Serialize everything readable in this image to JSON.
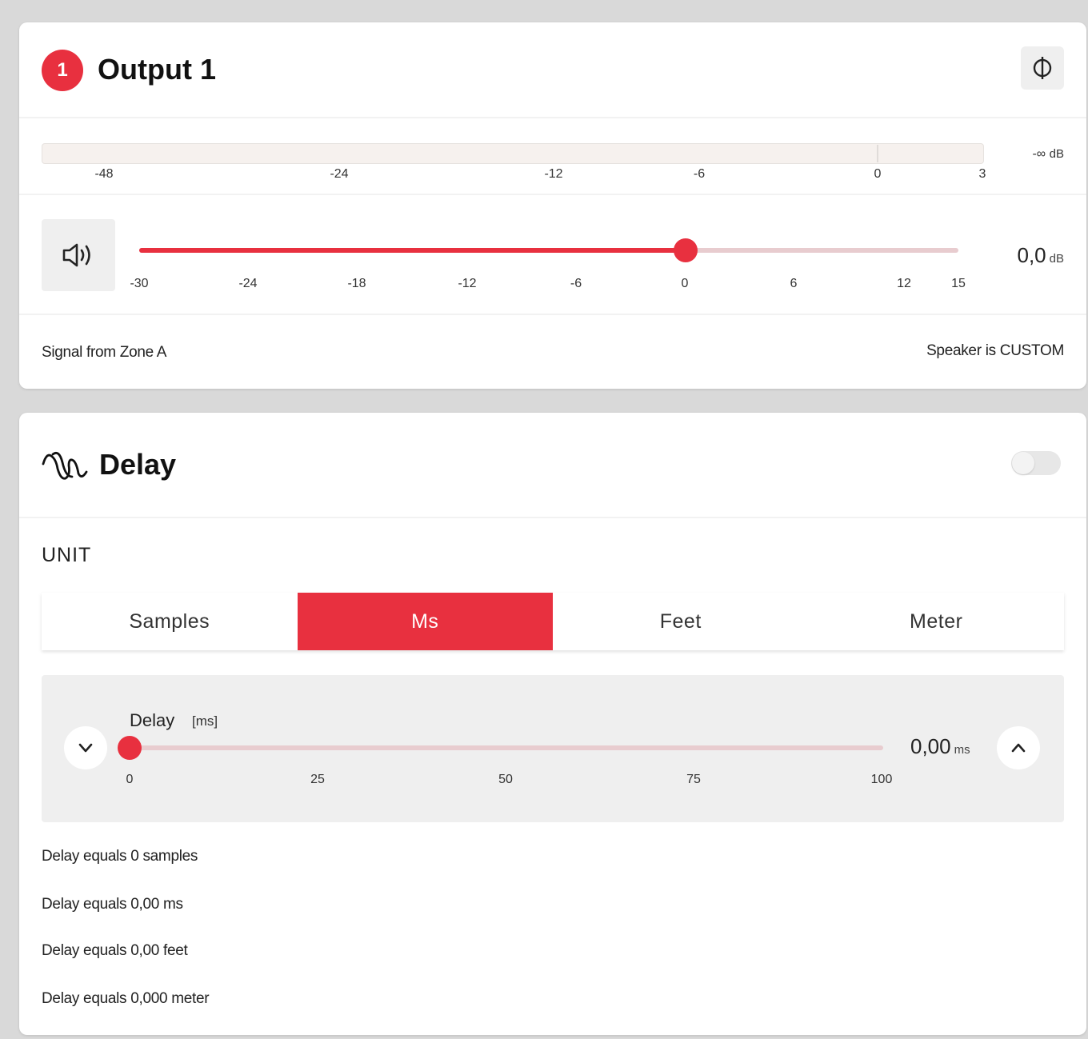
{
  "output": {
    "badge": "1",
    "title": "Output 1",
    "phase_icon": "phase-invert-icon",
    "meter": {
      "ticks": [
        "-48",
        "-24",
        "-12",
        "-6",
        "0",
        "3"
      ],
      "readout_value": "-∞",
      "readout_unit": "dB"
    },
    "volume": {
      "icon": "speaker-icon",
      "min": -30,
      "max": 15,
      "value": 0,
      "ticks": [
        "-30",
        "-24",
        "-18",
        "-12",
        "-6",
        "0",
        "6",
        "12",
        "15"
      ],
      "display_value": "0,0",
      "display_unit": "dB"
    },
    "signal_source": "Signal from Zone A",
    "speaker_type": "Speaker is CUSTOM"
  },
  "delay": {
    "title": "Delay",
    "icon": "delay-wave-icon",
    "enabled": false,
    "unit_label": "UNIT",
    "units": [
      "Samples",
      "Ms",
      "Feet",
      "Meter"
    ],
    "selected_unit": "Ms",
    "slider": {
      "label": "Delay",
      "unit": "[ms]",
      "min": 0,
      "max": 100,
      "value": 0,
      "ticks": [
        "0",
        "25",
        "50",
        "75",
        "100"
      ],
      "display_value": "0,00",
      "display_unit": "ms"
    },
    "equals": [
      "Delay equals 0 samples",
      "Delay equals 0,00 ms",
      "Delay equals 0,00 feet",
      "Delay equals 0,000 meter"
    ]
  },
  "colors": {
    "accent": "#e8303f",
    "track": "#e8cccf",
    "panel": "#efefef",
    "background": "#d9d9d9"
  }
}
